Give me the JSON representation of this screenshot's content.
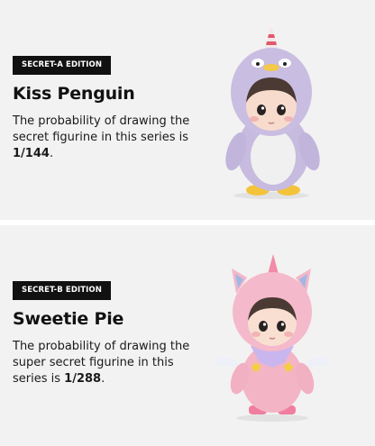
{
  "cards": [
    {
      "badge": "SECRET-A EDITION",
      "title": "Kiss Penguin",
      "desc_pre": "The probability of drawing the secret figurine in this series is",
      "odds": "1/144",
      "desc_post": ".",
      "figure_icon": "penguin-costume-figurine",
      "colors": {
        "costume": "#c9bde0",
        "belly": "#eeeeee",
        "beak": "#f4c84a"
      }
    },
    {
      "badge": "SECRET-B EDITION",
      "title": "Sweetie Pie",
      "desc_pre": "The probability of drawing the super secret figurine in this series is",
      "odds": "1/288",
      "desc_post": ".",
      "figure_icon": "pink-unicorn-costume-figurine",
      "colors": {
        "costume": "#f3b7c8",
        "collar": "#c9b6ee",
        "horn": "#f28aa8"
      }
    }
  ]
}
